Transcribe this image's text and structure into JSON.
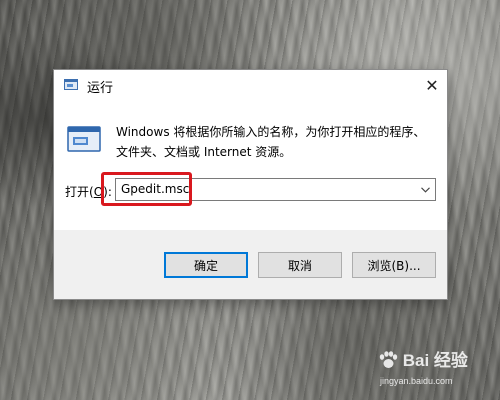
{
  "dialog": {
    "title": "运行",
    "description": "Windows 将根据你所输入的名称，为你打开相应的程序、文件夹、文档或 Internet 资源。",
    "open_label_prefix": "打开(",
    "open_label_accel": "O",
    "open_label_suffix": "):",
    "input_value": "Gpedit.msc",
    "buttons": {
      "ok": "确定",
      "cancel": "取消",
      "browse": "浏览(B)..."
    },
    "close_glyph": "✕"
  },
  "annotation": {
    "highlight_color": "#d9181e"
  },
  "watermark": {
    "brand": "Bai 经验",
    "url": "jingyan.baidu.com"
  },
  "colors": {
    "default_button_border": "#0078d7",
    "footer_background": "#f0f0f0"
  },
  "icons": [
    "run-app-icon",
    "close-icon",
    "dropdown-chevron-icon",
    "baidu-paw-icon"
  ]
}
